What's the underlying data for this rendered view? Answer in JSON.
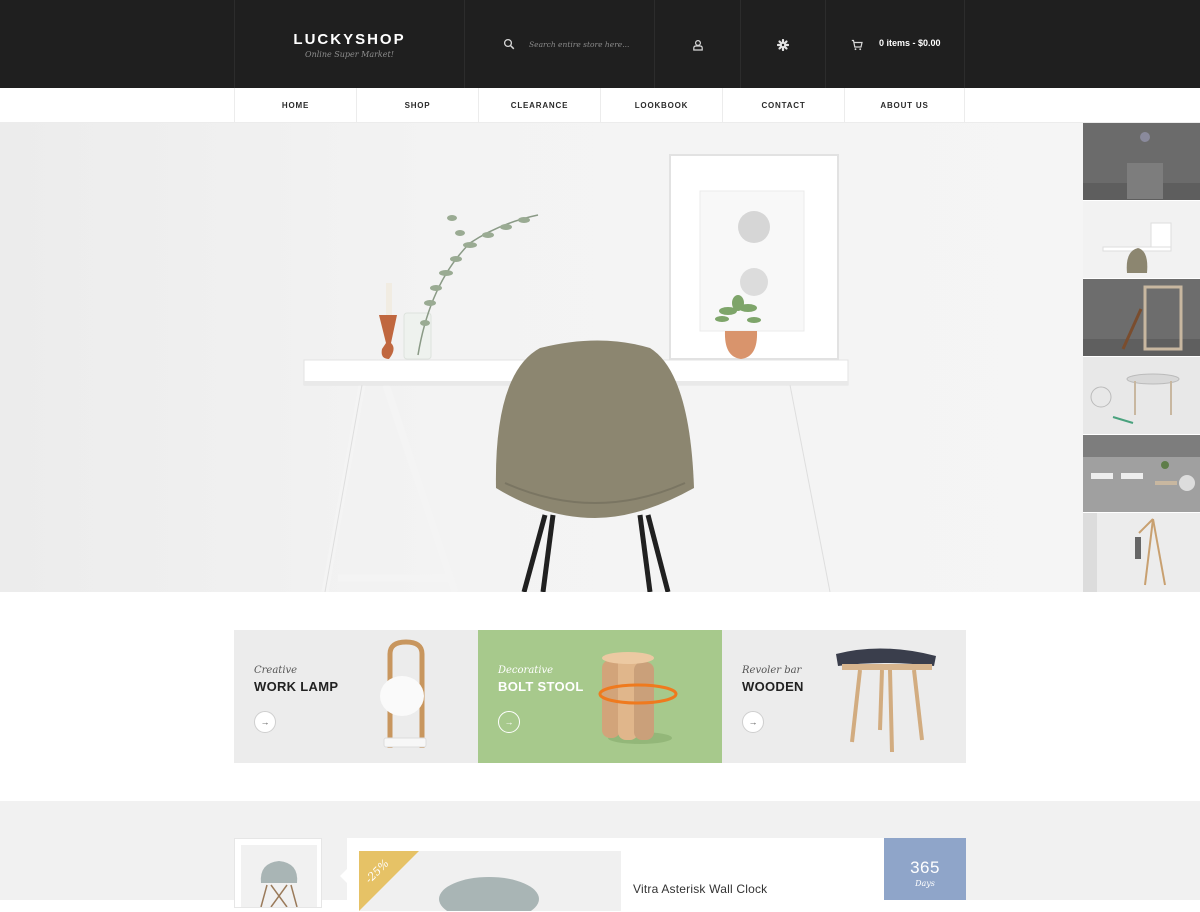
{
  "header": {
    "logo_title": "LUCKYSHOP",
    "logo_subtitle": "Online Super Market!",
    "search_placeholder": "Search entire store here...",
    "cart_summary": "0 items - $0.00"
  },
  "nav": {
    "items": [
      {
        "label": "HOME"
      },
      {
        "label": "SHOP"
      },
      {
        "label": "CLEARANCE"
      },
      {
        "label": "LOOKBOOK"
      },
      {
        "label": "CONTACT"
      },
      {
        "label": "ABOUT US"
      }
    ]
  },
  "banners": [
    {
      "subtitle": "Creative",
      "title": "WORK LAMP",
      "button": "→",
      "bg": "#ececec"
    },
    {
      "subtitle": "Decorative",
      "title": "BOLT STOOL",
      "button": "→",
      "bg": "#a7c98c"
    },
    {
      "subtitle": "Revoler bar",
      "title": "WOODEN",
      "button": "→",
      "bg": "#ececec"
    }
  ],
  "deal": {
    "discount_badge": "-25%",
    "product_title": "Vitra Asterisk Wall Clock",
    "countdown_value": "365",
    "countdown_unit": "Days"
  },
  "colors": {
    "header_bg": "#1f1f1f",
    "accent_green": "#a7c98c",
    "badge_yellow": "#e6c266",
    "countdown_blue": "#8fa5c9"
  },
  "icons": [
    "search-icon",
    "user-icon",
    "gear-icon",
    "cart-icon",
    "arrow-right-icon"
  ]
}
